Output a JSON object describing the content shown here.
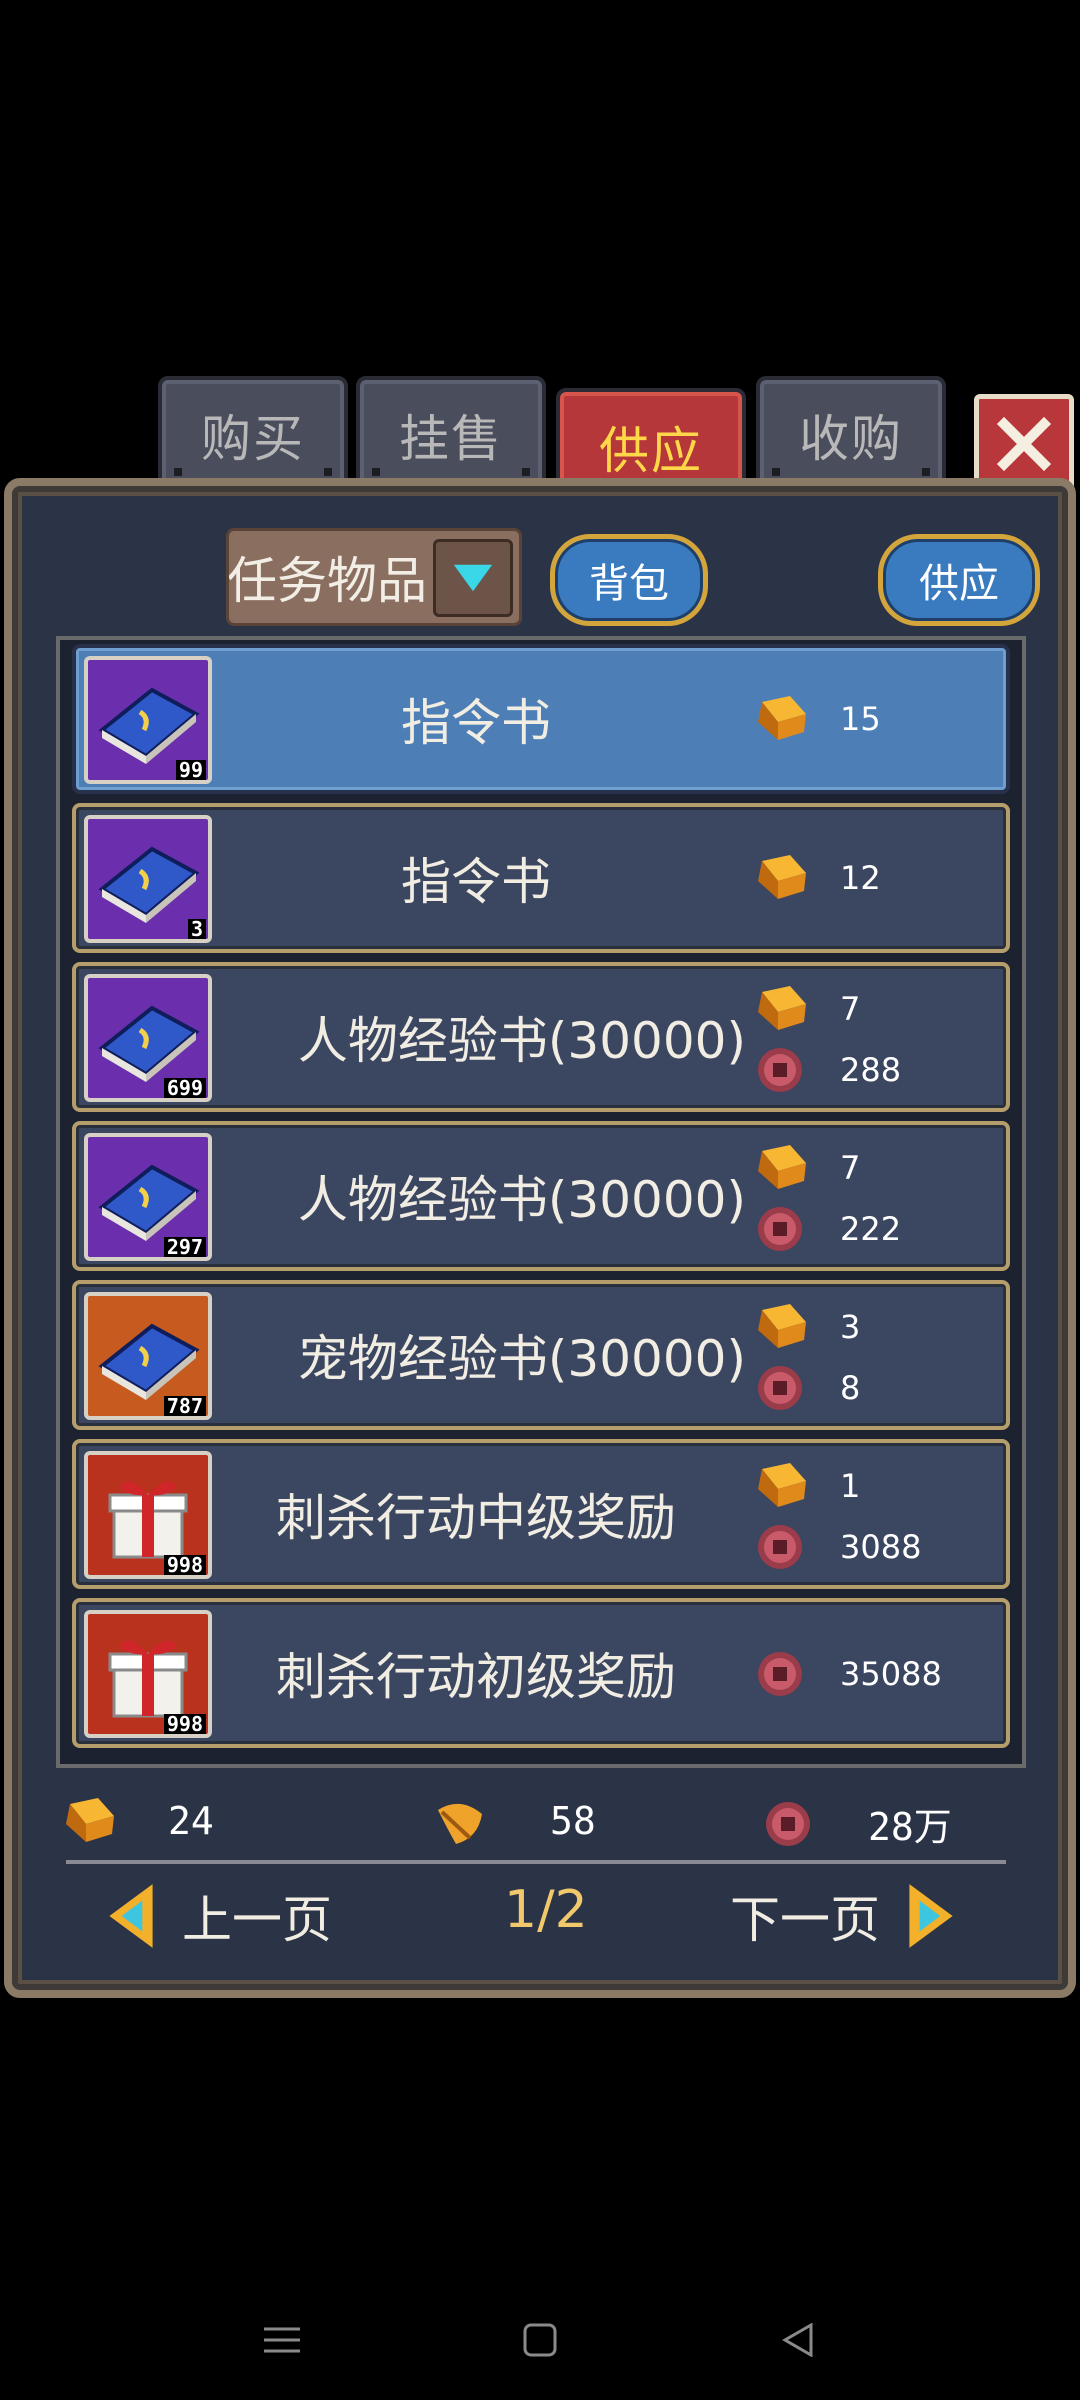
{
  "tabs": [
    {
      "label": "购买",
      "active": false
    },
    {
      "label": "挂售",
      "active": false
    },
    {
      "label": "供应",
      "active": true
    },
    {
      "label": "收购",
      "active": false
    }
  ],
  "filter": {
    "selected": "任务物品"
  },
  "buttons": {
    "bag": "背包",
    "supply": "供应"
  },
  "items": [
    {
      "name": "指令书",
      "count": "99",
      "icon": "book-icon",
      "gold": "15",
      "coin": null
    },
    {
      "name": "指令书",
      "count": "3",
      "icon": "book-icon",
      "gold": "12",
      "coin": null
    },
    {
      "name": "人物经验书(30000)",
      "count": "699",
      "icon": "book-icon",
      "gold": "7",
      "coin": "288"
    },
    {
      "name": "人物经验书(30000)",
      "count": "297",
      "icon": "book-icon",
      "gold": "7",
      "coin": "222"
    },
    {
      "name": "宠物经验书(30000)",
      "count": "787",
      "icon": "book-icon",
      "gold": "3",
      "coin": "8"
    },
    {
      "name": "刺杀行动中级奖励",
      "count": "998",
      "icon": "gift-icon",
      "gold": "1",
      "coin": "3088"
    },
    {
      "name": "刺杀行动初级奖励",
      "count": "998",
      "icon": "gift-icon",
      "gold": null,
      "coin": "35088"
    }
  ],
  "footer": {
    "gold": "24",
    "leaf": "58",
    "coin": "28万"
  },
  "pager": {
    "prev": "上一页",
    "page": "1/2",
    "next": "下一页"
  },
  "colors": {
    "accent_gold": "#f2c86c",
    "active_tab": "#b5373a",
    "selected_row": "#4d7fb6"
  }
}
